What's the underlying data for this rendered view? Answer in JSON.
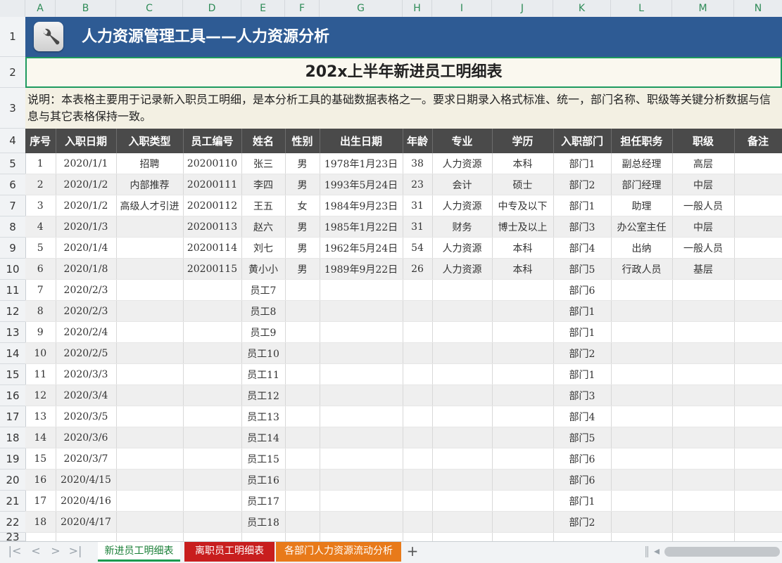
{
  "columns": [
    "A",
    "B",
    "C",
    "D",
    "E",
    "F",
    "G",
    "H",
    "I",
    "J",
    "K",
    "L",
    "M",
    "N"
  ],
  "row_numbers": [
    "1",
    "2",
    "3",
    "4",
    "5",
    "6",
    "7",
    "8",
    "9",
    "10",
    "11",
    "12",
    "13",
    "14",
    "15",
    "16",
    "17",
    "18",
    "19",
    "20",
    "21",
    "22",
    "23"
  ],
  "title": "人力资源管理工具——人力资源分析",
  "subtitle": "202x上半年新进员工明细表",
  "note": "说明：本表格主要用于记录新入职员工明细，是本分析工具的基础数据表格之一。要求日期录入格式标准、统一，部门名称、职级等关键分析数据与信息与其它表格保持一致。",
  "table": {
    "headers": [
      "序号",
      "入职日期",
      "入职类型",
      "员工编号",
      "姓名",
      "性别",
      "出生日期",
      "年龄",
      "专业",
      "学历",
      "入职部门",
      "担任职务",
      "职级",
      "备注"
    ],
    "rows": [
      [
        "1",
        "2020/1/1",
        "招聘",
        "20200110",
        "张三",
        "男",
        "1978年1月23日",
        "38",
        "人力资源",
        "本科",
        "部门1",
        "副总经理",
        "高层",
        ""
      ],
      [
        "2",
        "2020/1/2",
        "内部推荐",
        "20200111",
        "李四",
        "男",
        "1993年5月24日",
        "23",
        "会计",
        "硕士",
        "部门2",
        "部门经理",
        "中层",
        ""
      ],
      [
        "3",
        "2020/1/2",
        "高级人才引进",
        "20200112",
        "王五",
        "女",
        "1984年9月23日",
        "31",
        "人力资源",
        "中专及以下",
        "部门1",
        "助理",
        "一般人员",
        ""
      ],
      [
        "4",
        "2020/1/3",
        "",
        "20200113",
        "赵六",
        "男",
        "1985年1月22日",
        "31",
        "财务",
        "博士及以上",
        "部门3",
        "办公室主任",
        "中层",
        ""
      ],
      [
        "5",
        "2020/1/4",
        "",
        "20200114",
        "刘七",
        "男",
        "1962年5月24日",
        "54",
        "人力资源",
        "本科",
        "部门4",
        "出纳",
        "一般人员",
        ""
      ],
      [
        "6",
        "2020/1/8",
        "",
        "20200115",
        "黄小小",
        "男",
        "1989年9月22日",
        "26",
        "人力资源",
        "本科",
        "部门5",
        "行政人员",
        "基层",
        ""
      ],
      [
        "7",
        "2020/2/3",
        "",
        "",
        "员工7",
        "",
        "",
        "",
        "",
        "",
        "部门6",
        "",
        "",
        ""
      ],
      [
        "8",
        "2020/2/3",
        "",
        "",
        "员工8",
        "",
        "",
        "",
        "",
        "",
        "部门1",
        "",
        "",
        ""
      ],
      [
        "9",
        "2020/2/4",
        "",
        "",
        "员工9",
        "",
        "",
        "",
        "",
        "",
        "部门1",
        "",
        "",
        ""
      ],
      [
        "10",
        "2020/2/5",
        "",
        "",
        "员工10",
        "",
        "",
        "",
        "",
        "",
        "部门2",
        "",
        "",
        ""
      ],
      [
        "11",
        "2020/3/3",
        "",
        "",
        "员工11",
        "",
        "",
        "",
        "",
        "",
        "部门1",
        "",
        "",
        ""
      ],
      [
        "12",
        "2020/3/4",
        "",
        "",
        "员工12",
        "",
        "",
        "",
        "",
        "",
        "部门3",
        "",
        "",
        ""
      ],
      [
        "13",
        "2020/3/5",
        "",
        "",
        "员工13",
        "",
        "",
        "",
        "",
        "",
        "部门4",
        "",
        "",
        ""
      ],
      [
        "14",
        "2020/3/6",
        "",
        "",
        "员工14",
        "",
        "",
        "",
        "",
        "",
        "部门5",
        "",
        "",
        ""
      ],
      [
        "15",
        "2020/3/7",
        "",
        "",
        "员工15",
        "",
        "",
        "",
        "",
        "",
        "部门6",
        "",
        "",
        ""
      ],
      [
        "16",
        "2020/4/15",
        "",
        "",
        "员工16",
        "",
        "",
        "",
        "",
        "",
        "部门6",
        "",
        "",
        ""
      ],
      [
        "17",
        "2020/4/16",
        "",
        "",
        "员工17",
        "",
        "",
        "",
        "",
        "",
        "部门1",
        "",
        "",
        ""
      ],
      [
        "18",
        "2020/4/17",
        "",
        "",
        "员工18",
        "",
        "",
        "",
        "",
        "",
        "部门2",
        "",
        "",
        ""
      ],
      [
        "",
        "",
        "",
        "",
        "",
        "",
        "",
        "",
        "",
        "",
        "",
        "",
        "",
        ""
      ]
    ]
  },
  "sheet_tabs": [
    "新进员工明细表",
    "离职员工明细表",
    "各部门人力资源流动分析"
  ],
  "add_sheet_label": "+",
  "nav_icons": [
    "first-sheet-icon",
    "prev-sheet-icon",
    "next-sheet-icon",
    "last-sheet-icon"
  ],
  "colors": {
    "title_bar": "#2e5b94",
    "header_bg": "#4a4a4a",
    "tab_active": "#1a9a4f",
    "tab2": "#c81e1e",
    "tab3": "#e87a1a"
  }
}
